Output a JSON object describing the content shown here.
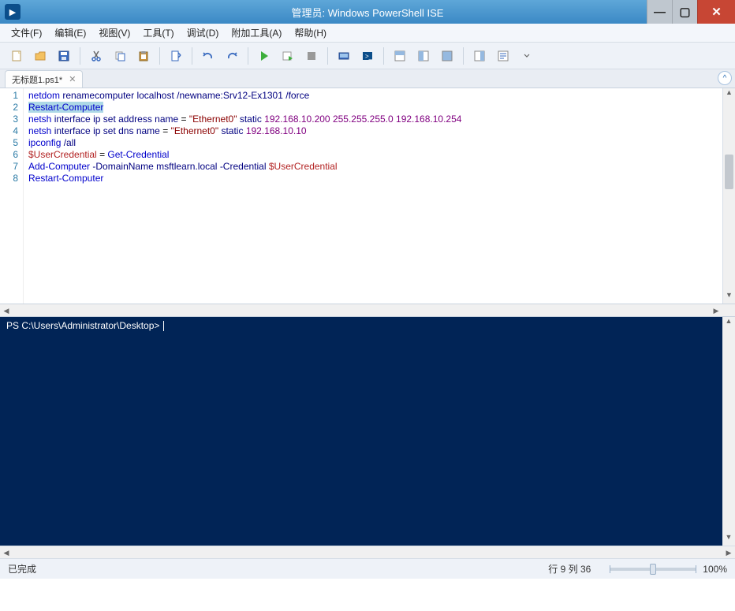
{
  "window": {
    "title": "管理员: Windows PowerShell ISE"
  },
  "menu": {
    "file": "文件(F)",
    "edit": "编辑(E)",
    "view": "视图(V)",
    "tools": "工具(T)",
    "debug": "调试(D)",
    "addons": "附加工具(A)",
    "help": "帮助(H)"
  },
  "tab": {
    "label": "无标题1.ps1*"
  },
  "code": {
    "lines": [
      {
        "n": "1",
        "tokens": [
          [
            "kw",
            "netdom"
          ],
          [
            "",
            ""
          ],
          [
            "arg",
            "renamecomputer"
          ],
          [
            "",
            ""
          ],
          [
            "arg",
            "localhost"
          ],
          [
            "",
            ""
          ],
          [
            "arg",
            "/newname:Srv12-Ex1301"
          ],
          [
            "",
            ""
          ],
          [
            "arg",
            "/force"
          ]
        ]
      },
      {
        "n": "2",
        "tokens": [
          [
            "hl kw",
            "Restart-Computer"
          ]
        ]
      },
      {
        "n": "3",
        "tokens": [
          [
            "kw",
            "netsh"
          ],
          [
            "",
            ""
          ],
          [
            "arg",
            "interface"
          ],
          [
            "",
            ""
          ],
          [
            "arg",
            "ip"
          ],
          [
            "",
            ""
          ],
          [
            "arg",
            "set"
          ],
          [
            "",
            ""
          ],
          [
            "arg",
            "address"
          ],
          [
            "",
            ""
          ],
          [
            "arg",
            "name"
          ],
          [
            "",
            ""
          ],
          [
            "",
            "="
          ],
          [
            "",
            ""
          ],
          [
            "str",
            "\"Ethernet0\""
          ],
          [
            "",
            ""
          ],
          [
            "arg",
            "static"
          ],
          [
            "",
            ""
          ],
          [
            "pur",
            "192.168.10.200"
          ],
          [
            "",
            ""
          ],
          [
            "pur",
            "255.255.255.0"
          ],
          [
            "",
            ""
          ],
          [
            "pur",
            "192.168.10.254"
          ]
        ]
      },
      {
        "n": "4",
        "tokens": [
          [
            "kw",
            "netsh"
          ],
          [
            "",
            ""
          ],
          [
            "arg",
            "interface"
          ],
          [
            "",
            ""
          ],
          [
            "arg",
            "ip"
          ],
          [
            "",
            ""
          ],
          [
            "arg",
            "set"
          ],
          [
            "",
            ""
          ],
          [
            "arg",
            "dns"
          ],
          [
            "",
            ""
          ],
          [
            "arg",
            "name"
          ],
          [
            "",
            ""
          ],
          [
            "",
            "="
          ],
          [
            "",
            ""
          ],
          [
            "str",
            "\"Ethernet0\""
          ],
          [
            "",
            ""
          ],
          [
            "arg",
            "static"
          ],
          [
            "",
            ""
          ],
          [
            "pur",
            "192.168.10.10"
          ]
        ]
      },
      {
        "n": "5",
        "tokens": [
          [
            "kw",
            "ipconfig"
          ],
          [
            "",
            ""
          ],
          [
            "arg",
            "/all"
          ]
        ]
      },
      {
        "n": "6",
        "tokens": [
          [
            "var",
            "$UserCredential"
          ],
          [
            "",
            ""
          ],
          [
            "",
            "="
          ],
          [
            "",
            ""
          ],
          [
            "kw",
            "Get-Credential"
          ]
        ]
      },
      {
        "n": "7",
        "tokens": [
          [
            "kw",
            "Add-Computer"
          ],
          [
            "",
            ""
          ],
          [
            "arg",
            "-DomainName"
          ],
          [
            "",
            ""
          ],
          [
            "arg",
            "msftlearn.local"
          ],
          [
            "",
            ""
          ],
          [
            "arg",
            "-Credential"
          ],
          [
            "",
            ""
          ],
          [
            "var",
            "$UserCredential"
          ]
        ]
      },
      {
        "n": "8",
        "tokens": [
          [
            "kw",
            "Restart-Computer"
          ]
        ]
      }
    ]
  },
  "console": {
    "prompt": "PS C:\\Users\\Administrator\\Desktop> "
  },
  "status": {
    "left": "已完成",
    "pos": "行 9 列 36",
    "zoom": "100%"
  }
}
